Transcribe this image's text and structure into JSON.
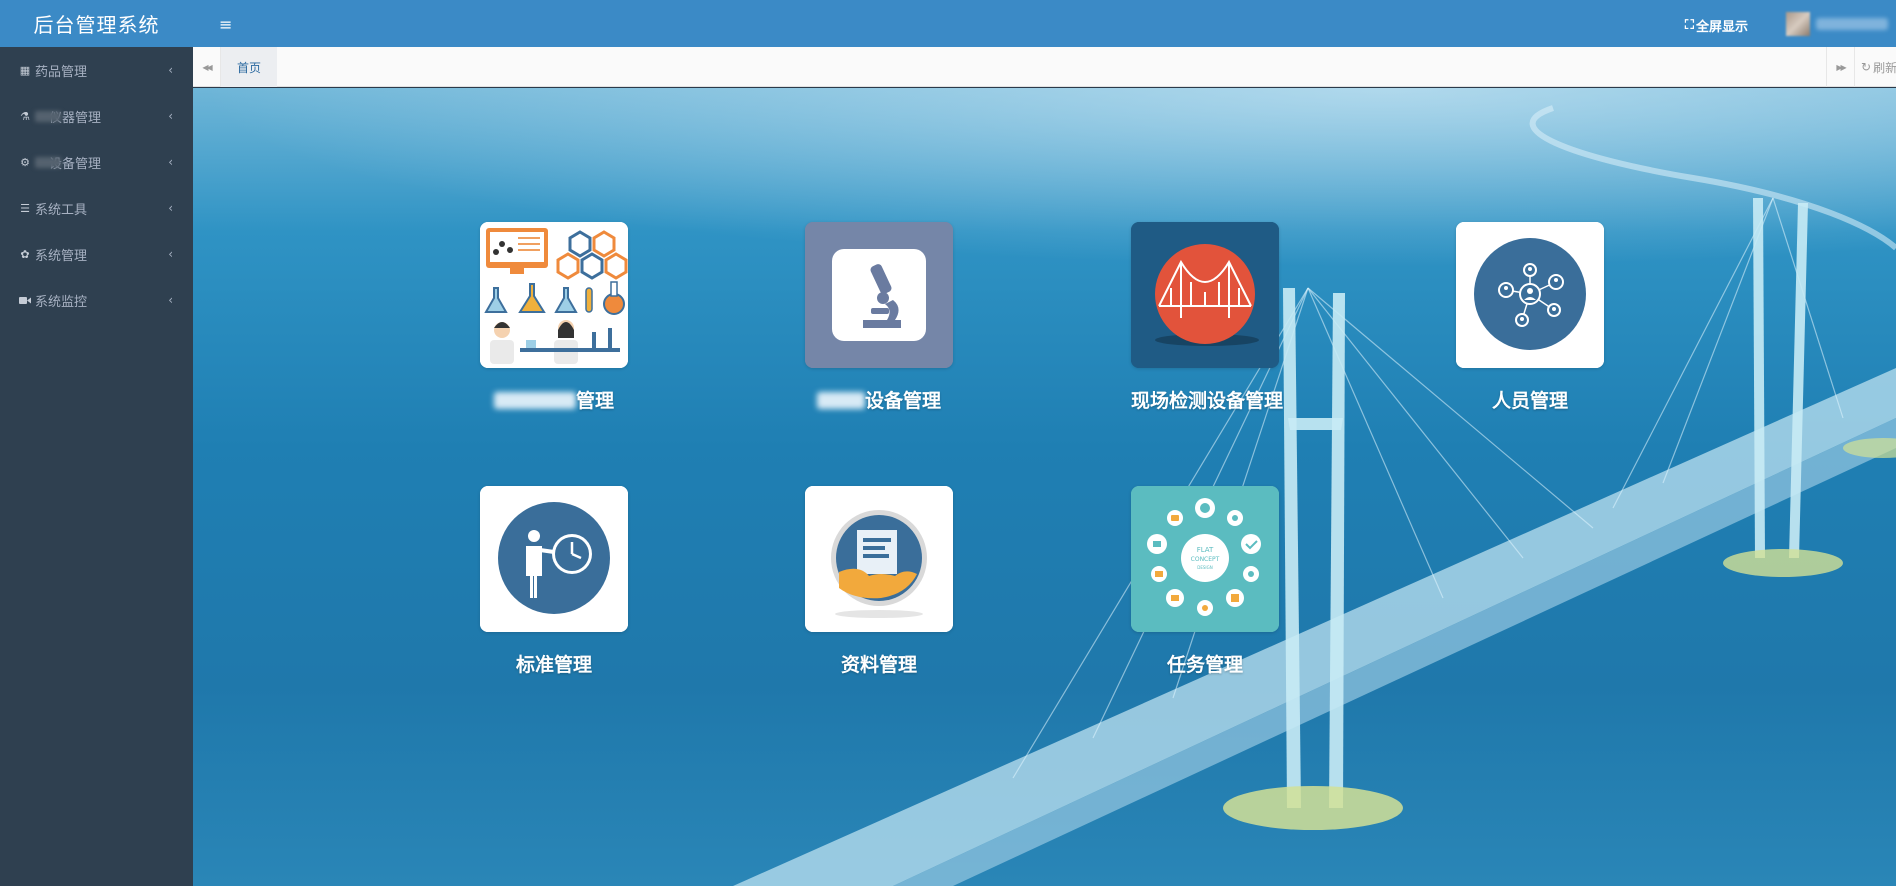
{
  "app": {
    "title": "后台管理系统"
  },
  "sidebar": {
    "items": [
      {
        "icon": "table-icon",
        "prefix": "",
        "label": "药品管理"
      },
      {
        "icon": "flask-icon",
        "prefix": "blur",
        "label": "仪器管理"
      },
      {
        "icon": "gears-icon",
        "prefix": "blur",
        "label": "设备管理"
      },
      {
        "icon": "list-icon",
        "prefix": "",
        "label": "系统工具"
      },
      {
        "icon": "gear-icon",
        "prefix": "",
        "label": "系统管理"
      },
      {
        "icon": "video-camera-icon",
        "prefix": "",
        "label": "系统监控"
      }
    ],
    "chevron": "‹"
  },
  "header": {
    "menu_icon": "≡",
    "fullscreen_label": "全屏显示"
  },
  "tabs": {
    "home": "首页",
    "left_arrow": "◀◀",
    "right_arrow": "▶▶",
    "refresh": "刷新"
  },
  "tiles": [
    {
      "label_suffix": "管理",
      "blurred_prefix": true,
      "icon": "laboratory-icon"
    },
    {
      "label_suffix": "设备管理",
      "blurred_prefix": true,
      "icon": "microscope-icon"
    },
    {
      "label": "现场检测设备管理",
      "icon": "bridge-icon"
    },
    {
      "label": "人员管理",
      "icon": "people-network-icon"
    },
    {
      "label": "标准管理",
      "icon": "presenter-clock-icon"
    },
    {
      "label": "资料管理",
      "icon": "document-hand-icon"
    },
    {
      "label": "任务管理",
      "icon": "flat-concept-icon",
      "icon_text": [
        "FLAT",
        "CONCEPT",
        "DESIGN"
      ]
    }
  ],
  "colors": {
    "sidebar_bg": "#2f4050",
    "header_bg": "#3b8ac6",
    "sea": "#1f7fb3"
  }
}
